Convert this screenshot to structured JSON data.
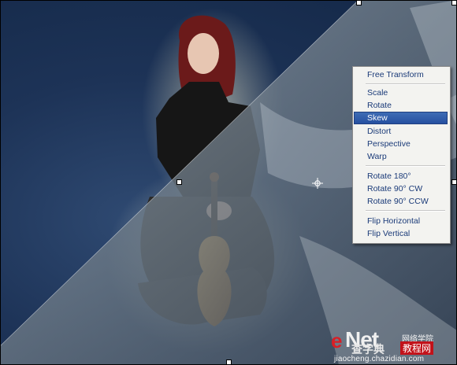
{
  "context_menu": {
    "items": [
      {
        "label": "Free Transform",
        "selected": false
      },
      {
        "label": "Scale",
        "selected": false
      },
      {
        "label": "Rotate",
        "selected": false
      },
      {
        "label": "Skew",
        "selected": true
      },
      {
        "label": "Distort",
        "selected": false
      },
      {
        "label": "Perspective",
        "selected": false
      },
      {
        "label": "Warp",
        "selected": false
      },
      {
        "label": "Rotate 180°",
        "selected": false
      },
      {
        "label": "Rotate 90° CW",
        "selected": false
      },
      {
        "label": "Rotate 90° CCW",
        "selected": false
      },
      {
        "label": "Flip Horizontal",
        "selected": false
      },
      {
        "label": "Flip Vertical",
        "selected": false
      }
    ]
  },
  "watermark": {
    "brand_e": "e",
    "brand_net": "Net",
    "chinese_main": "查字典",
    "chinese_top": "网络学院",
    "chinese_box": "教程网",
    "url": "jiaocheng.chazidian.com"
  },
  "colors": {
    "background_blue": "#1d3357",
    "menu_selected": "#2f5ca8",
    "menu_text": "#1a3a78",
    "watermark_red": "#d81f26"
  }
}
